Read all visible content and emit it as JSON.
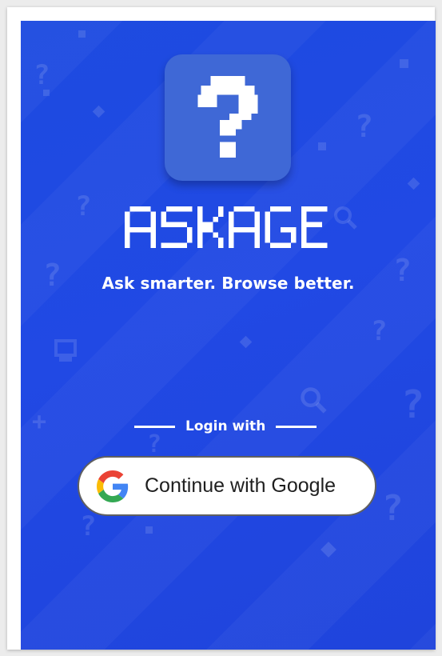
{
  "app": {
    "name": "ASKAGE",
    "tagline": "Ask smarter. Browse better.",
    "logo_glyph": "?"
  },
  "login": {
    "divider_label": "Login with",
    "google_button_label": "Continue with Google"
  },
  "colors": {
    "background": "#1f47e0",
    "logo_tile": "#3f68d6",
    "text": "#ffffff",
    "button_bg": "#ffffff",
    "button_border": "#606060"
  }
}
